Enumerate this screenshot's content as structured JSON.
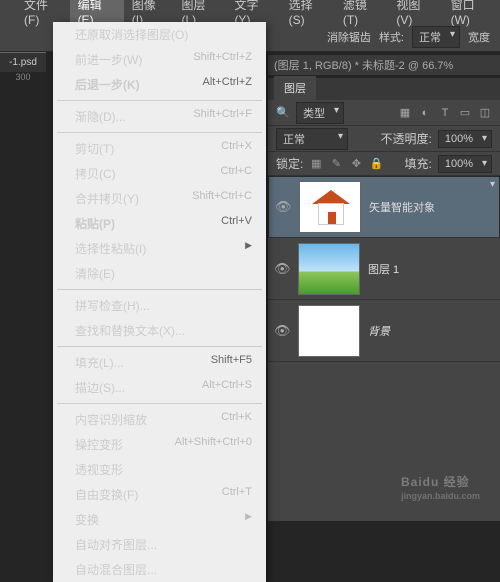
{
  "menubar": [
    "文件(F)",
    "编辑(E)",
    "图像(I)",
    "图层(L)",
    "文字(Y)",
    "选择(S)",
    "滤镜(T)",
    "视图(V)",
    "窗口(W)"
  ],
  "active_menu_index": 1,
  "toolbar": {
    "antialias": "消除锯齿",
    "style_label": "样式:",
    "style_value": "正常",
    "width_label": "宽度"
  },
  "doc_tab_left": "-1.psd",
  "ruler_mark": "300",
  "dropdown": {
    "groups": [
      [
        {
          "label": "还原取消选择图层(O)",
          "sc": "",
          "dim": false
        },
        {
          "label": "前进一步(W)",
          "sc": "Shift+Ctrl+Z",
          "dim": true
        },
        {
          "label": "后退一步(K)",
          "sc": "Alt+Ctrl+Z",
          "dim": false,
          "bold": true
        }
      ],
      [
        {
          "label": "渐隐(D)...",
          "sc": "Shift+Ctrl+F",
          "dim": true
        }
      ],
      [
        {
          "label": "剪切(T)",
          "sc": "Ctrl+X",
          "dim": true
        },
        {
          "label": "拷贝(C)",
          "sc": "Ctrl+C",
          "dim": true
        },
        {
          "label": "合并拷贝(Y)",
          "sc": "Shift+Ctrl+C",
          "dim": true
        },
        {
          "label": "粘贴(P)",
          "sc": "Ctrl+V",
          "dim": false,
          "bold": true
        },
        {
          "label": "选择性粘贴(I)",
          "sc": "",
          "dim": false,
          "arrow": true
        },
        {
          "label": "清除(E)",
          "sc": "",
          "dim": true
        }
      ],
      [
        {
          "label": "拼写检查(H)...",
          "sc": "",
          "dim": true
        },
        {
          "label": "查找和替换文本(X)...",
          "sc": "",
          "dim": true
        }
      ],
      [
        {
          "label": "填充(L)...",
          "sc": "Shift+F5",
          "dim": false
        },
        {
          "label": "描边(S)...",
          "sc": "Alt+Ctrl+S",
          "dim": true
        }
      ],
      [
        {
          "label": "内容识别缩放",
          "sc": "Ctrl+K",
          "dim": true
        },
        {
          "label": "操控变形",
          "sc": "Alt+Shift+Ctrl+0",
          "dim": true
        },
        {
          "label": "透视变形",
          "sc": "",
          "dim": true
        },
        {
          "label": "自由变换(F)",
          "sc": "Ctrl+T",
          "dim": true
        },
        {
          "label": "变换",
          "sc": "",
          "dim": true,
          "arrow": true
        },
        {
          "label": "自动对齐图层...",
          "sc": "",
          "dim": true
        },
        {
          "label": "自动混合图层...",
          "sc": "",
          "dim": true
        }
      ]
    ]
  },
  "doc_tabs": "(图层 1, RGB/8) *     未标题-2 @ 66.7%",
  "panel": {
    "tabs": [
      "图层"
    ],
    "kind_label": "类型",
    "blend_label": "正常",
    "opacity_label": "不透明度:",
    "opacity_value": "100%",
    "lock_label": "锁定:",
    "fill_label": "填充:",
    "fill_value": "100%"
  },
  "layers": [
    {
      "name": "矢量智能对象",
      "eye": true,
      "type": "house",
      "selected": true
    },
    {
      "name": "图层 1",
      "eye": true,
      "type": "photo",
      "selected": false
    },
    {
      "name": "背景",
      "eye": true,
      "type": "white",
      "selected": false,
      "italic": true
    }
  ],
  "watermark": {
    "brand": "Baidu 经验",
    "url": "jingyan.baidu.com"
  }
}
